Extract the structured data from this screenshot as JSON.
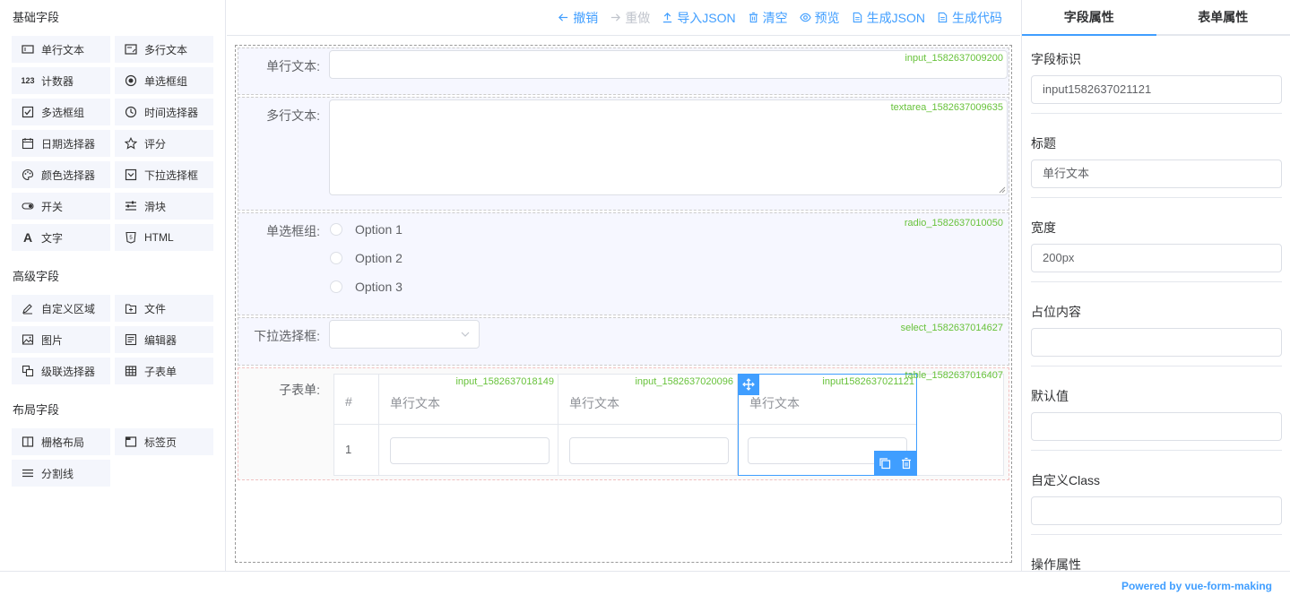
{
  "sidebar": {
    "groups": [
      {
        "title": "基础字段",
        "items": [
          {
            "label": "单行文本",
            "icon": "input-icon"
          },
          {
            "label": "多行文本",
            "icon": "textarea-icon"
          },
          {
            "label": "计数器",
            "icon": "number-icon"
          },
          {
            "label": "单选框组",
            "icon": "radio-icon"
          },
          {
            "label": "多选框组",
            "icon": "checkbox-icon"
          },
          {
            "label": "时间选择器",
            "icon": "clock-icon"
          },
          {
            "label": "日期选择器",
            "icon": "calendar-icon"
          },
          {
            "label": "评分",
            "icon": "star-icon"
          },
          {
            "label": "颜色选择器",
            "icon": "palette-icon"
          },
          {
            "label": "下拉选择框",
            "icon": "select-icon"
          },
          {
            "label": "开关",
            "icon": "switch-icon"
          },
          {
            "label": "滑块",
            "icon": "slider-icon"
          },
          {
            "label": "文字",
            "icon": "text-icon"
          },
          {
            "label": "HTML",
            "icon": "html-icon"
          }
        ]
      },
      {
        "title": "高级字段",
        "items": [
          {
            "label": "自定义区域",
            "icon": "edit-icon"
          },
          {
            "label": "文件",
            "icon": "file-icon"
          },
          {
            "label": "图片",
            "icon": "image-icon"
          },
          {
            "label": "编辑器",
            "icon": "editor-icon"
          },
          {
            "label": "级联选择器",
            "icon": "cascader-icon"
          },
          {
            "label": "子表单",
            "icon": "table-icon"
          }
        ]
      },
      {
        "title": "布局字段",
        "items": [
          {
            "label": "栅格布局",
            "icon": "grid-icon"
          },
          {
            "label": "标签页",
            "icon": "tabs-icon"
          },
          {
            "label": "分割线",
            "icon": "divider-icon"
          }
        ]
      }
    ]
  },
  "toolbar": {
    "undo": "撤销",
    "redo": "重做",
    "import_json": "导入JSON",
    "clear": "清空",
    "preview": "预览",
    "gen_json": "生成JSON",
    "gen_code": "生成代码"
  },
  "canvas": {
    "input_field": {
      "label": "单行文本:",
      "key": "input_1582637009200"
    },
    "textarea_field": {
      "label": "多行文本:",
      "key": "textarea_1582637009635"
    },
    "radio_field": {
      "label": "单选框组:",
      "key": "radio_1582637010050",
      "options": [
        "Option 1",
        "Option 2",
        "Option 3"
      ]
    },
    "select_field": {
      "label": "下拉选择框:",
      "key": "select_1582637014627"
    },
    "table_field": {
      "label": "子表单:",
      "key": "table_1582637016407",
      "index_header": "#",
      "row_index": "1",
      "columns": [
        {
          "header": "单行文本",
          "key": "input_1582637018149"
        },
        {
          "header": "单行文本",
          "key": "input_1582637020096"
        },
        {
          "header": "单行文本",
          "key": "input1582637021121"
        }
      ]
    }
  },
  "panel": {
    "tabs": [
      "字段属性",
      "表单属性"
    ],
    "props": [
      {
        "label": "字段标识",
        "value": "input1582637021121"
      },
      {
        "label": "标题",
        "value": "单行文本"
      },
      {
        "label": "宽度",
        "value": "200px"
      },
      {
        "label": "占位内容",
        "value": ""
      },
      {
        "label": "默认值",
        "value": ""
      },
      {
        "label": "自定义Class",
        "value": ""
      }
    ],
    "last_label": "操作属性"
  },
  "footer": {
    "powered": "Powered by vue-form-making"
  },
  "colors": {
    "accent": "#409eff",
    "key_green": "#67c23a"
  }
}
